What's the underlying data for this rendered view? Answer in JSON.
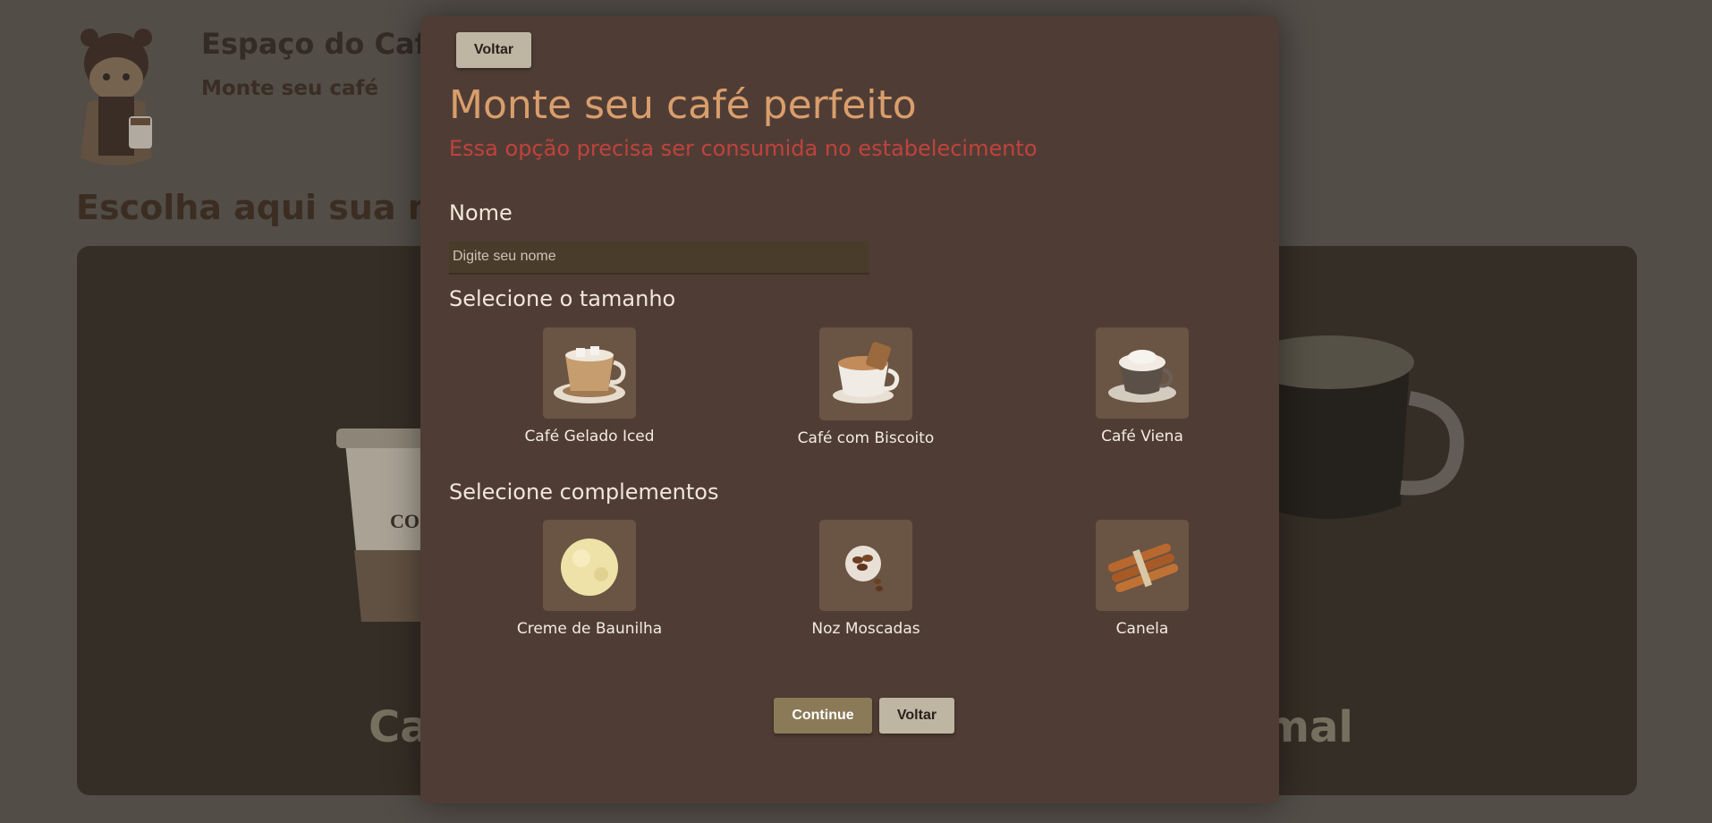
{
  "background": {
    "brand_title": "Espaço do Café",
    "brand_subtitle": "Monte seu café",
    "heading": "Escolha aqui sua m",
    "card_left_caption": "Ca",
    "card_right_caption": "mal",
    "cup_brand_text": "CO"
  },
  "modal": {
    "top_back_label": "Voltar",
    "title": "Monte seu café perfeito",
    "warning": "Essa opção precisa ser consumida no estabelecimento",
    "name_label": "Nome",
    "name_placeholder": "Digite seu nome",
    "name_value": "",
    "size_label": "Selecione o tamanho",
    "sizes": [
      {
        "label": "Café Gelado Iced",
        "icon": "iced-coffee-cup-icon"
      },
      {
        "label": "Café com Biscoito",
        "icon": "coffee-with-biscuit-icon"
      },
      {
        "label": "Café Viena",
        "icon": "vienna-coffee-icon"
      }
    ],
    "extras_label": "Selecione complementos",
    "extras": [
      {
        "label": "Creme de Baunilha",
        "icon": "vanilla-ice-cream-icon"
      },
      {
        "label": "Noz Moscadas",
        "icon": "nutmeg-icon"
      },
      {
        "label": "Canela",
        "icon": "cinnamon-sticks-icon"
      }
    ],
    "continue_label": "Continue",
    "back_label": "Voltar"
  },
  "colors": {
    "modal_bg": "#4f3d35",
    "title": "#d99e6c",
    "warning": "#c0423c",
    "text": "#f1e6da",
    "button_light": "#bfb5a3",
    "button_dark": "#8a7a58"
  }
}
